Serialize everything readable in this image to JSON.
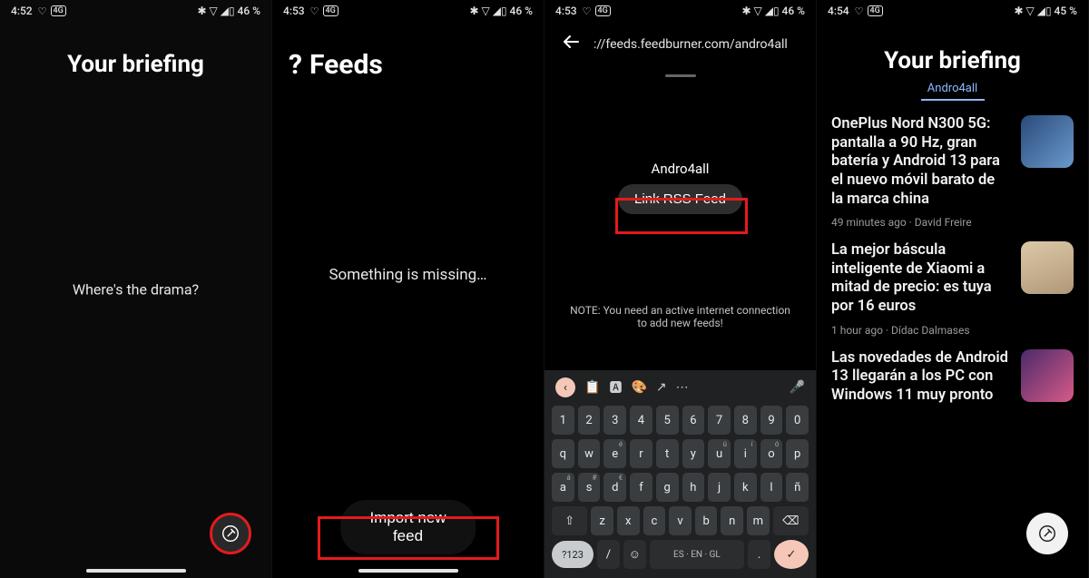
{
  "screens": {
    "s1": {
      "status": {
        "time": "4:52",
        "battery": "46 %"
      },
      "title": "Your briefing",
      "empty_text": "Where's the drama?"
    },
    "s2": {
      "status": {
        "time": "4:53",
        "battery": "46 %"
      },
      "help_icon": "?",
      "title": "Feeds",
      "empty_text": "Something is missing…",
      "import_button": "Import new feed"
    },
    "s3": {
      "status": {
        "time": "4:53",
        "battery": "46 %"
      },
      "url": "://feeds.feedburner.com/andro4all",
      "feed_name": "Andro4all",
      "link_button": "Link RSS Feed",
      "note": "NOTE: You need an active internet connection to add new feeds!",
      "keyboard": {
        "numbers": [
          "1",
          "2",
          "3",
          "4",
          "5",
          "6",
          "7",
          "8",
          "9",
          "0"
        ],
        "row1": [
          {
            "k": "q"
          },
          {
            "k": "w"
          },
          {
            "k": "e",
            "s": "é"
          },
          {
            "k": "r"
          },
          {
            "k": "t"
          },
          {
            "k": "y"
          },
          {
            "k": "u",
            "s": "ú"
          },
          {
            "k": "i",
            "s": "í"
          },
          {
            "k": "o",
            "s": "ó"
          },
          {
            "k": "p"
          }
        ],
        "row2": [
          {
            "k": "a",
            "s": "á"
          },
          {
            "k": "s",
            "s": "#"
          },
          {
            "k": "d",
            "s": "€"
          },
          {
            "k": "f"
          },
          {
            "k": "g"
          },
          {
            "k": "h"
          },
          {
            "k": "j"
          },
          {
            "k": "k"
          },
          {
            "k": "l"
          },
          {
            "k": "ñ"
          }
        ],
        "row3": [
          "z",
          "x",
          "c",
          "v",
          "b",
          "n",
          "m"
        ],
        "lang": "ES · EN · GL",
        "switch": "?123"
      }
    },
    "s4": {
      "status": {
        "time": "4:54",
        "battery": "45 %"
      },
      "title": "Your briefing",
      "active_tab": "Andro4all",
      "items": [
        {
          "title": "OnePlus Nord N300 5G: pantalla a 90 Hz, gran batería y Android 13 para el nuevo móvil barato de la marca china",
          "meta": "49 minutes ago · David Freire",
          "thumb": "blue"
        },
        {
          "title": "La mejor báscula inteligente de Xiaomi a mitad de precio: es tuya por 16 euros",
          "meta": "1 hour ago · Dídac Dalmases",
          "thumb": "tan"
        },
        {
          "title": "Las novedades de Android 13 llegarán a los PC con Windows 11 muy pronto",
          "meta": "",
          "thumb": "pink"
        }
      ]
    }
  }
}
